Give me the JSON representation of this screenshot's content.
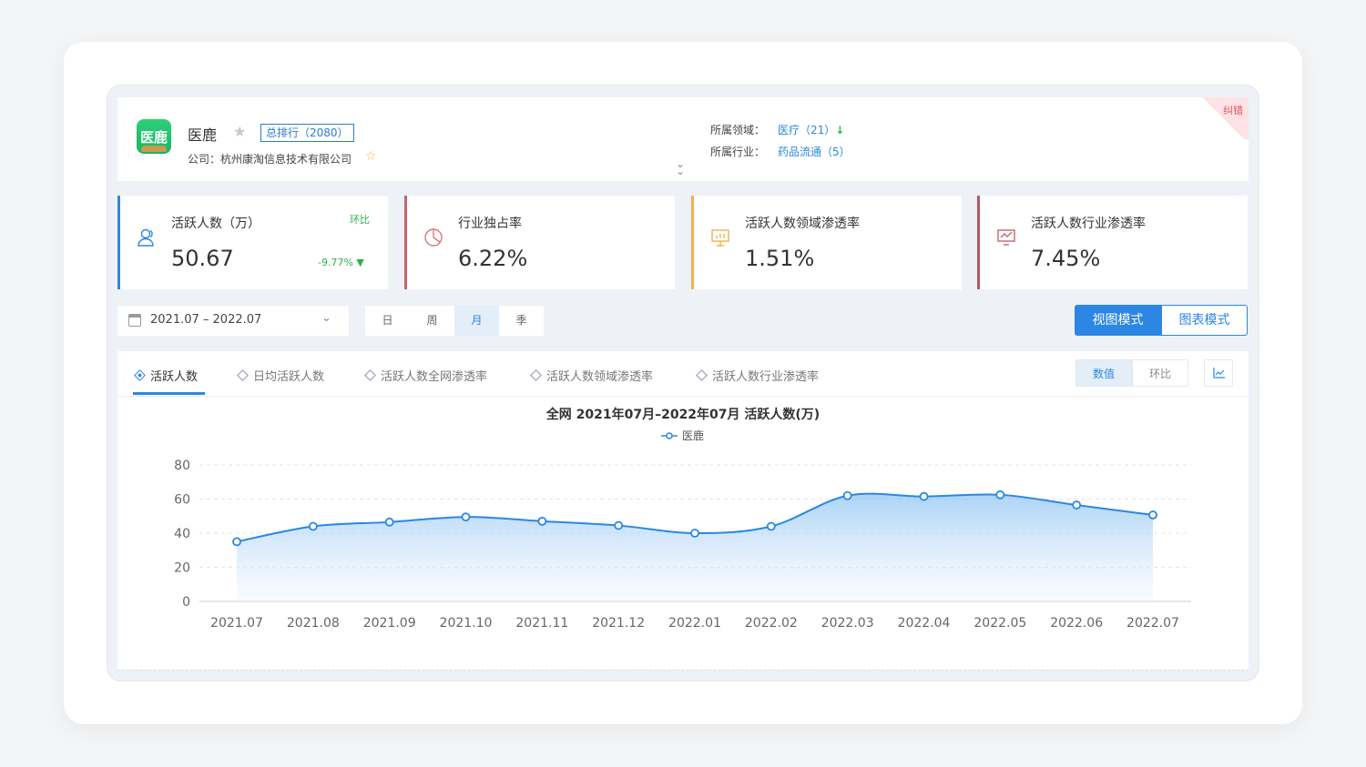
{
  "header": {
    "app_logo_text": "医鹿",
    "app_name": "医鹿",
    "rank_badge": "总排行（2080）",
    "company_label": "公司：",
    "company_name": "杭州康淘信息技术有限公司",
    "domain_label": "所属领域：",
    "domain_value": "医疗（21）",
    "industry_label": "所属行业：",
    "industry_value": "药品流通（5）",
    "correction": "纠错"
  },
  "metrics": [
    {
      "label": "活跃人数（万）",
      "value": "50.67",
      "ratio_label": "环比",
      "ratio_value": "-9.77%",
      "accent": "#2b87e3"
    },
    {
      "label": "行业独占率",
      "value": "6.22%",
      "accent": "#c6646e"
    },
    {
      "label": "活跃人数领域渗透率",
      "value": "1.51%",
      "accent": "#f0b44c"
    },
    {
      "label": "活跃人数行业渗透率",
      "value": "7.45%",
      "accent": "#b05a63"
    }
  ],
  "date_range": "2021.07 – 2022.07",
  "periods": [
    "日",
    "周",
    "月",
    "季"
  ],
  "active_period": "月",
  "modes": [
    "视图模式",
    "图表模式"
  ],
  "tabs": [
    "活跃人数",
    "日均活跃人数",
    "活跃人数全网渗透率",
    "活跃人数领域渗透率",
    "活跃人数行业渗透率"
  ],
  "value_toggle": [
    "数值",
    "环比"
  ],
  "colors": {
    "primary": "#2b87e3",
    "positive": "#2bb24c",
    "correction": "#e8505b"
  },
  "chart_data": {
    "type": "area",
    "title": "全网 2021年07月–2022年07月 活跃人数(万)",
    "legend": [
      "医鹿"
    ],
    "legend_position": "top-center",
    "categories": [
      "2021.07",
      "2021.08",
      "2021.09",
      "2021.10",
      "2021.11",
      "2021.12",
      "2022.01",
      "2022.02",
      "2022.03",
      "2022.04",
      "2022.05",
      "2022.06",
      "2022.07"
    ],
    "series": [
      {
        "name": "医鹿",
        "values": [
          35,
          44,
          46.5,
          49.5,
          47,
          44.5,
          40,
          44,
          62,
          61.5,
          62.5,
          56.5,
          50.67
        ]
      }
    ],
    "yticks": [
      0,
      20,
      40,
      60,
      80
    ],
    "ylim": [
      0,
      80
    ],
    "grid": true
  }
}
